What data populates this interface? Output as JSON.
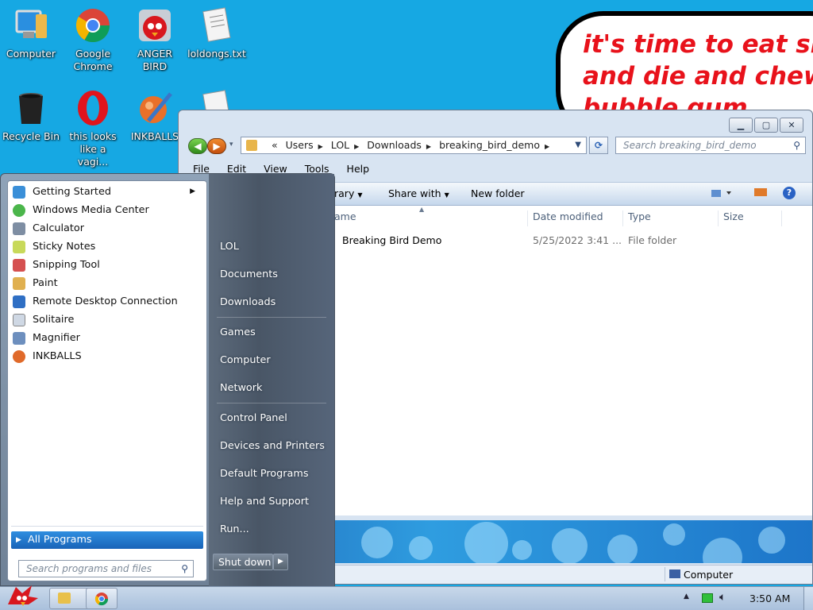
{
  "desktop": {
    "icons": [
      {
        "label": "Computer"
      },
      {
        "label": "Google Chrome"
      },
      {
        "label": "ANGER BIRD"
      },
      {
        "label": "loldongs.txt"
      },
      {
        "label": "Recycle Bin"
      },
      {
        "label": "this looks like a vagi..."
      },
      {
        "label": "INKBALLS"
      }
    ],
    "bubble_lines": [
      "it's time to eat shit",
      "and die and chew",
      "bubble gum"
    ]
  },
  "explorer": {
    "breadcrumb_prefix": "«",
    "breadcrumb": [
      "Users",
      "LOL",
      "Downloads",
      "breaking_bird_demo"
    ],
    "search_placeholder": "Search breaking_bird_demo",
    "menu": [
      "File",
      "Edit",
      "View",
      "Tools",
      "Help"
    ],
    "toolbar": {
      "library": "rary",
      "share": "Share with",
      "new_folder": "New folder"
    },
    "columns": {
      "name": "ame",
      "date": "Date modified",
      "type": "Type",
      "size": "Size"
    },
    "rows": [
      {
        "name": "Breaking Bird Demo",
        "date": "5/25/2022 3:41 ...",
        "type": "File folder"
      }
    ],
    "status": "Computer"
  },
  "start_menu": {
    "programs": [
      {
        "label": "Getting Started",
        "icon": "getting-started-icon",
        "color": "#3a8fd8"
      },
      {
        "label": "Windows Media Center",
        "icon": "media-center-icon",
        "color": "#4bb64b"
      },
      {
        "label": "Calculator",
        "icon": "calculator-icon",
        "color": "#7e8ea3"
      },
      {
        "label": "Sticky Notes",
        "icon": "sticky-notes-icon",
        "color": "#c8d95a"
      },
      {
        "label": "Snipping Tool",
        "icon": "scissors-icon",
        "color": "#d55050"
      },
      {
        "label": "Paint",
        "icon": "paint-icon",
        "color": "#e0b050"
      },
      {
        "label": "Remote Desktop Connection",
        "icon": "remote-desktop-icon",
        "color": "#2f6fc4"
      },
      {
        "label": "Solitaire",
        "icon": "solitaire-icon",
        "color": "#cfd8e4"
      },
      {
        "label": "Magnifier",
        "icon": "magnifier-icon",
        "color": "#6d8fbe"
      },
      {
        "label": "INKBALLS",
        "icon": "inkballs-icon",
        "color": "#e06a2a"
      }
    ],
    "all_programs": "All Programs",
    "search_placeholder": "Search programs and files",
    "places": [
      "LOL",
      "Documents",
      "Downloads",
      "Games",
      "Computer",
      "Network",
      "Control Panel",
      "Devices and Printers",
      "Default Programs",
      "Help and Support",
      "Run..."
    ],
    "shutdown": "Shut down"
  },
  "taskbar": {
    "clock": "3:50 AM"
  }
}
